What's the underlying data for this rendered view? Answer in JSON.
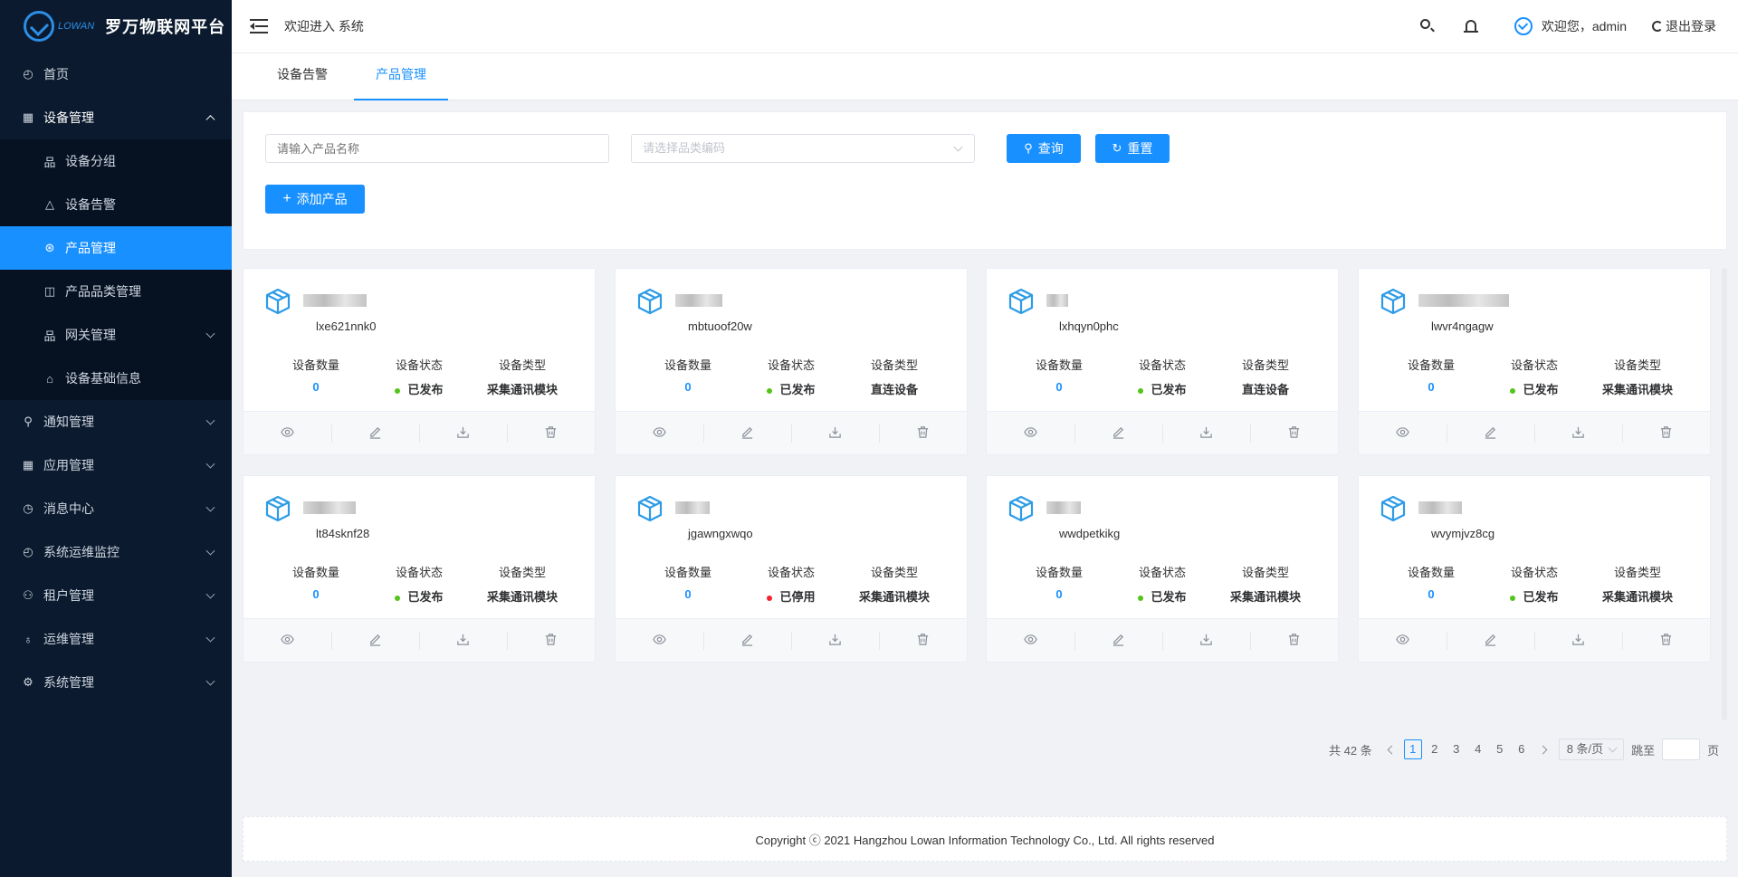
{
  "app": {
    "logo_sub": "LOWAN",
    "title": "罗万物联网平台"
  },
  "sidebar": {
    "items": [
      {
        "label": "首页",
        "icon": "dashboard-icon"
      },
      {
        "label": "设备管理",
        "icon": "grid-icon",
        "expanded": true,
        "children": [
          {
            "label": "设备分组",
            "icon": "group-icon"
          },
          {
            "label": "设备告警",
            "icon": "warning-icon"
          },
          {
            "label": "产品管理",
            "icon": "product-icon",
            "active": true
          },
          {
            "label": "产品品类管理",
            "icon": "category-icon"
          },
          {
            "label": "网关管理",
            "icon": "gateway-icon",
            "has_children": true
          },
          {
            "label": "设备基础信息",
            "icon": "info-icon"
          }
        ]
      },
      {
        "label": "通知管理",
        "icon": "link-icon"
      },
      {
        "label": "应用管理",
        "icon": "apps-icon"
      },
      {
        "label": "消息中心",
        "icon": "history-icon"
      },
      {
        "label": "系统运维监控",
        "icon": "monitor-icon"
      },
      {
        "label": "租户管理",
        "icon": "tenant-icon"
      },
      {
        "label": "运维管理",
        "icon": "ops-icon"
      },
      {
        "label": "系统管理",
        "icon": "gear-icon"
      }
    ]
  },
  "header": {
    "welcome": "欢迎进入 系统",
    "user_greeting": "欢迎您，admin",
    "logout": "退出登录"
  },
  "tabs": [
    {
      "label": "设备告警",
      "active": false
    },
    {
      "label": "产品管理",
      "active": true
    }
  ],
  "search": {
    "name_placeholder": "请输入产品名称",
    "category_placeholder": "请选择品类编码",
    "query_button": "查询",
    "reset_button": "重置",
    "add_button": "添加产品"
  },
  "card_labels": {
    "count": "设备数量",
    "status": "设备状态",
    "type": "设备类型"
  },
  "products": [
    {
      "code": "lxe621nnk0",
      "count": "0",
      "status": "已发布",
      "status_color": "#52c41a",
      "type": "采集通讯模块"
    },
    {
      "code": "mbtuoof20w",
      "count": "0",
      "status": "已发布",
      "status_color": "#52c41a",
      "type": "直连设备"
    },
    {
      "code": "lxhqyn0phc",
      "count": "0",
      "status": "已发布",
      "status_color": "#52c41a",
      "type": "直连设备"
    },
    {
      "code": "lwvr4ngagw",
      "count": "0",
      "status": "已发布",
      "status_color": "#52c41a",
      "type": "采集通讯模块"
    },
    {
      "code": "lt84sknf28",
      "count": "0",
      "status": "已发布",
      "status_color": "#52c41a",
      "type": "采集通讯模块"
    },
    {
      "code": "jgawngxwqo",
      "count": "0",
      "status": "已停用",
      "status_color": "#f5222d",
      "type": "采集通讯模块"
    },
    {
      "code": "wwdpetkikg",
      "count": "0",
      "status": "已发布",
      "status_color": "#52c41a",
      "type": "采集通讯模块"
    },
    {
      "code": "wvymjvz8cg",
      "count": "0",
      "status": "已发布",
      "status_color": "#52c41a",
      "type": "采集通讯模块"
    }
  ],
  "pagination": {
    "total": "共 42 条",
    "pages": [
      "1",
      "2",
      "3",
      "4",
      "5",
      "6"
    ],
    "current": "1",
    "page_size": "8 条/页",
    "jump_label": "跳至",
    "page_suffix": "页"
  },
  "footer": {
    "copyright": "Copyright ⓒ 2021 Hangzhou Lowan Information Technology Co., Ltd. All rights reserved"
  },
  "colors": {
    "accent": "#1890ff",
    "sidebar_bg": "#0b1a2e",
    "published": "#52c41a",
    "disabled": "#f5222d"
  }
}
